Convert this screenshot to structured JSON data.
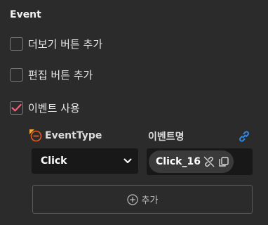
{
  "section": {
    "title": "Event"
  },
  "options": [
    {
      "label": "더보기 버튼 추가",
      "checked": false
    },
    {
      "label": "편집 버튼 추가",
      "checked": false
    },
    {
      "label": "이벤트 사용",
      "checked": true
    }
  ],
  "event_table": {
    "type_label": "EventType",
    "name_label": "이벤트명",
    "type_value": "Click",
    "name_value": "Click_16",
    "add_label": "추가"
  },
  "icons": {
    "remove": "remove-circle-icon",
    "link": "link-icon",
    "unlink": "unlink-icon",
    "copy": "copy-icon",
    "add": "plus-circle-icon",
    "dropdown": "chevron-down-icon"
  },
  "colors": {
    "checkmark": "#ff5a78",
    "remove": "#e85a1e",
    "link": "#2f8be6"
  }
}
